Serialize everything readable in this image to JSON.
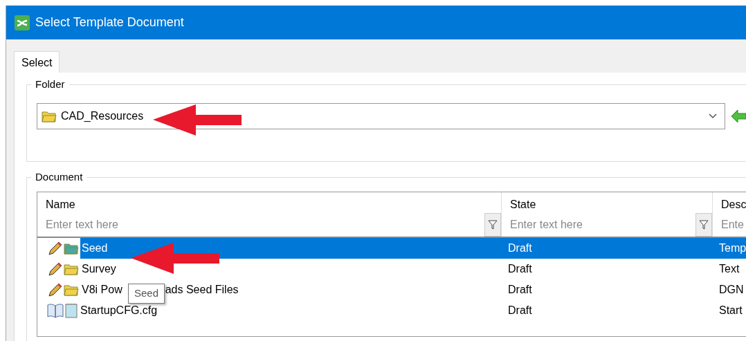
{
  "window": {
    "title": "Select Template Document"
  },
  "tabs": [
    {
      "label": "Select",
      "selected": true
    }
  ],
  "folder": {
    "legend": "Folder",
    "value": "CAD_Resources"
  },
  "document": {
    "legend": "Document",
    "columns": [
      {
        "label": "Name",
        "placeholder": "Enter text here"
      },
      {
        "label": "State",
        "placeholder": "Enter text here"
      },
      {
        "label": "Desc",
        "placeholder": "Ente"
      }
    ],
    "rows": [
      {
        "kind": "folder",
        "name_parts": [
          "Seed"
        ],
        "state": "Draft",
        "description": "Temp",
        "selected": true
      },
      {
        "kind": "folder",
        "name_parts": [
          "Survey"
        ],
        "state": "Draft",
        "description": "Text",
        "selected": false
      },
      {
        "kind": "folder",
        "name_parts": [
          "V8i Pow",
          "ads Seed Files"
        ],
        "state": "Draft",
        "description": "DGN",
        "selected": false
      },
      {
        "kind": "config",
        "name_parts": [
          "StartupCFG.cfg"
        ],
        "state": "Draft",
        "description": "Start",
        "selected": false
      }
    ],
    "tooltip": "Seed"
  }
}
